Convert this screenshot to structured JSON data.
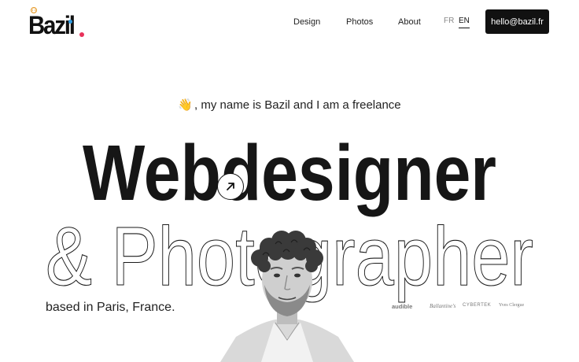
{
  "brand": {
    "logo_text": "Bazil",
    "colors": {
      "pink": "#e8315a",
      "blue": "#2f9be0",
      "crown": "#e8a23a"
    }
  },
  "nav": {
    "links": [
      {
        "label": "Design"
      },
      {
        "label": "Photos"
      },
      {
        "label": "About"
      }
    ],
    "languages": [
      {
        "label": "FR",
        "active": false
      },
      {
        "label": "EN",
        "active": true
      }
    ],
    "cta_label": "hello@bazil.fr"
  },
  "hero": {
    "intro_emoji": "👋",
    "intro_text": ", my name is Bazil and I am a freelance",
    "title_line1": "Webdesigner",
    "title_line2": "& Photographer",
    "location": "based in Paris, France.",
    "arrow_icon": "arrow-up-right-icon"
  },
  "clients": [
    "audible",
    "Ballantine's",
    "CYBERTEK",
    "Yves Clergue"
  ]
}
